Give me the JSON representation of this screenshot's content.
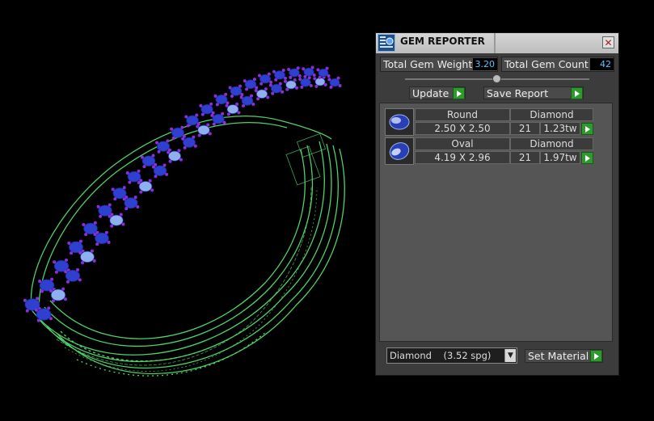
{
  "panel": {
    "title": "GEM REPORTER",
    "close_glyph": "✕",
    "stats": {
      "weight_label": "Total Gem Weight",
      "weight_value": "3.20",
      "count_label": "Total Gem Count",
      "count_value": "42"
    },
    "buttons": {
      "update_label": "Update",
      "save_report_label": "Save Report"
    },
    "gems": [
      {
        "shape": "Round",
        "material": "Diamond",
        "size": "2.50 X 2.50",
        "count": "21",
        "weight": "1.23tw"
      },
      {
        "shape": "Oval",
        "material": "Diamond",
        "size": "4.19 X 2.96",
        "count": "21",
        "weight": "1.97tw"
      }
    ],
    "footer": {
      "material_select_value": "Diamond    (3.52 spg)",
      "set_material_label": "Set Material"
    }
  },
  "viewport": {
    "colors": {
      "band": "#4fd16a",
      "gem_blue": "#2f3fcf",
      "gem_light": "#8fb0ee",
      "prong": "#8b2fd9"
    }
  }
}
